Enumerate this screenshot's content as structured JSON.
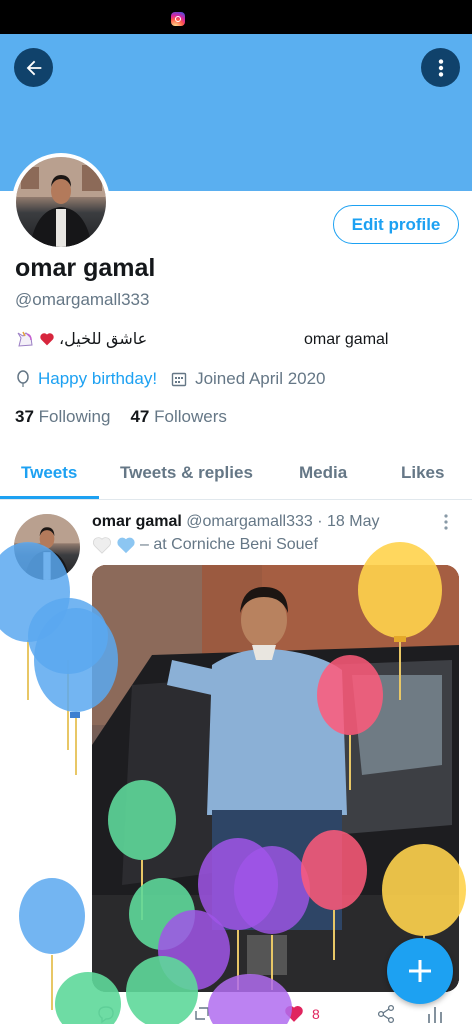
{
  "colors": {
    "banner": "#5aaff0",
    "accent": "#1da1f2",
    "muted": "#657786",
    "like": "#e0245e"
  },
  "header": {
    "back_icon": "arrow-left-icon",
    "menu_icon": "more-vertical-icon"
  },
  "profile": {
    "edit_label": "Edit profile",
    "name": "omar gamal",
    "handle": "@omargamall333",
    "bio_arabic": "عاشق للخيل،",
    "bio_name": "omar gamal",
    "birthday": "Happy birthday!",
    "joined": "Joined April 2020",
    "following_count": "37",
    "following_label": "Following",
    "followers_count": "47",
    "followers_label": "Followers"
  },
  "tabs": [
    {
      "label": "Tweets",
      "active": true
    },
    {
      "label": "Tweets & replies",
      "active": false
    },
    {
      "label": "Media",
      "active": false
    },
    {
      "label": "Likes",
      "active": false
    }
  ],
  "tweet": {
    "name": "omar gamal",
    "handle_time": "@omargamall333 · 18 May",
    "location": "– at Corniche Beni Souef",
    "like_count": "8"
  }
}
